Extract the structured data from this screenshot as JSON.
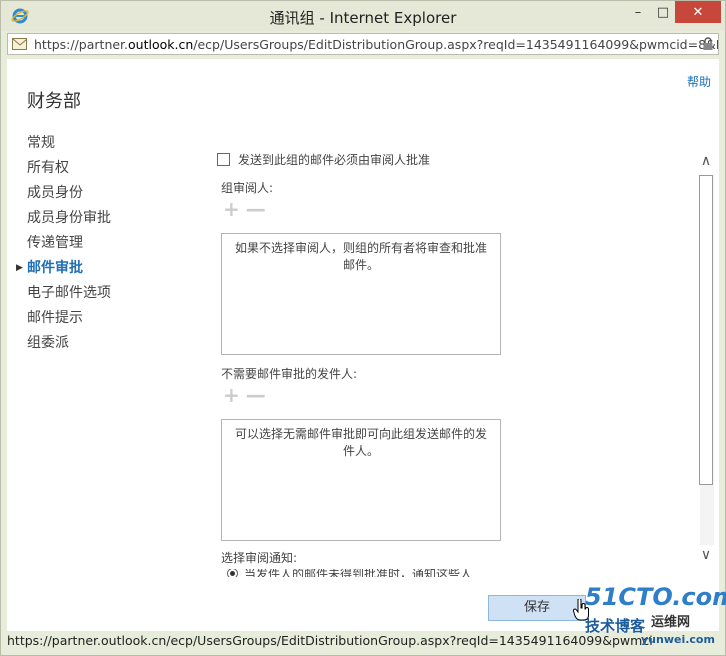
{
  "window": {
    "title": "通讯组 - Internet Explorer",
    "minimize": "–",
    "maximize": "□",
    "close": "✕"
  },
  "address": {
    "url_prefix": "https://partner.",
    "url_domain": "outlook.cn",
    "url_suffix": "/ecp/UsersGroups/EditDistributionGroup.aspx?reqId=1435491164099&pwmcid=8&Retur"
  },
  "page": {
    "help": "帮助",
    "title": "财务部"
  },
  "nav": {
    "items": [
      {
        "label": "常规"
      },
      {
        "label": "所有权"
      },
      {
        "label": "成员身份"
      },
      {
        "label": "成员身份审批"
      },
      {
        "label": "传递管理"
      },
      {
        "label": "邮件审批"
      },
      {
        "label": "电子邮件选项"
      },
      {
        "label": "邮件提示"
      },
      {
        "label": "组委派"
      }
    ],
    "active_index": 5
  },
  "form": {
    "require_moderation_label": "发送到此组的邮件必须由审阅人批准",
    "require_moderation_checked": false,
    "moderators_label": "组审阅人:",
    "moderators_hint": "如果不选择审阅人，则组的所有者将审查和批准邮件。",
    "bypass_label": "不需要邮件审批的发件人:",
    "bypass_hint": "可以选择无需邮件审批即可向此组发送邮件的发件人。",
    "notify_label": "选择审阅通知:",
    "notify_option": "当发件人的邮件未得到批准时，通知这些人",
    "add_symbol": "+",
    "remove_symbol": "—"
  },
  "actions": {
    "save": "保存"
  },
  "status": {
    "text": "https://partner.outlook.cn/ecp/UsersGroups/EditDistributionGroup.aspx?reqId=1435491164099&pwmci"
  },
  "watermark": {
    "brand": "51CTO.com",
    "sub": "技术博客",
    "site": "运维网",
    "url": "yunwei.com"
  },
  "colors": {
    "accent": "#1e6fb5",
    "chrome": "#e8ecda",
    "close": "#c7473b",
    "save_bg": "#cfe2f5"
  }
}
